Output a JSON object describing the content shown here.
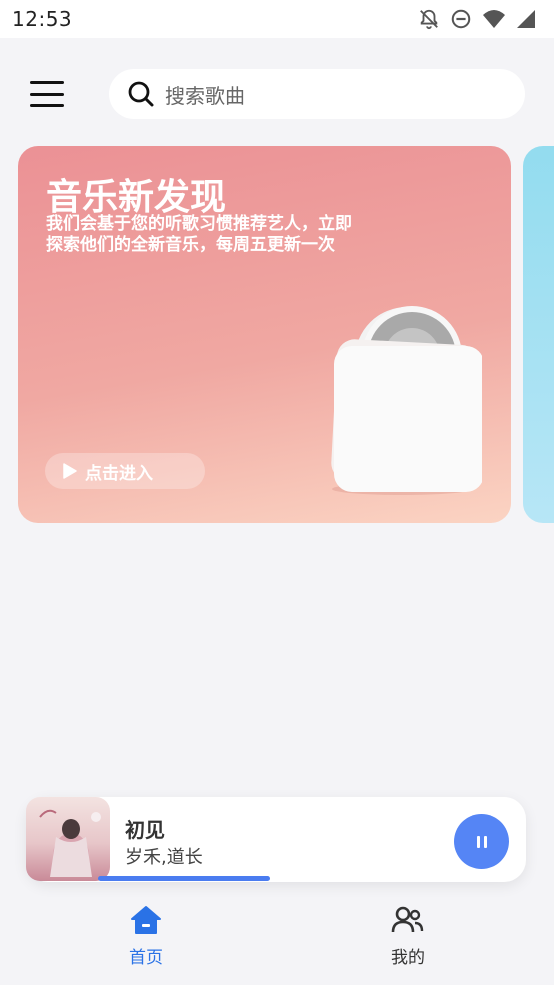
{
  "status_bar": {
    "time": "12:53",
    "icons": [
      "notifications-off-icon",
      "do-not-disturb-icon",
      "wifi-icon",
      "signal-icon"
    ]
  },
  "header": {
    "menu_icon": "menu-icon",
    "search": {
      "placeholder": "搜索歌曲",
      "icon": "search-icon"
    }
  },
  "banner": {
    "title": "音乐新发现",
    "description": "我们会基于您的听歌习惯推荐艺人，立即探索他们的全新音乐，每周五更新一次",
    "button_label": "点击进入",
    "colors": {
      "gradient_start": "#eb9195",
      "gradient_end": "#fbd4c3",
      "next_card": "#93dcef"
    }
  },
  "now_playing": {
    "title": "初见",
    "artist": "岁禾,道长",
    "progress": 0.41,
    "state": "playing",
    "accent_color": "#5585f5"
  },
  "bottom_nav": {
    "tabs": [
      {
        "label": "首页",
        "icon": "home-icon",
        "active": true
      },
      {
        "label": "我的",
        "icon": "users-icon",
        "active": false
      }
    ],
    "active_color": "#2a72e6"
  }
}
